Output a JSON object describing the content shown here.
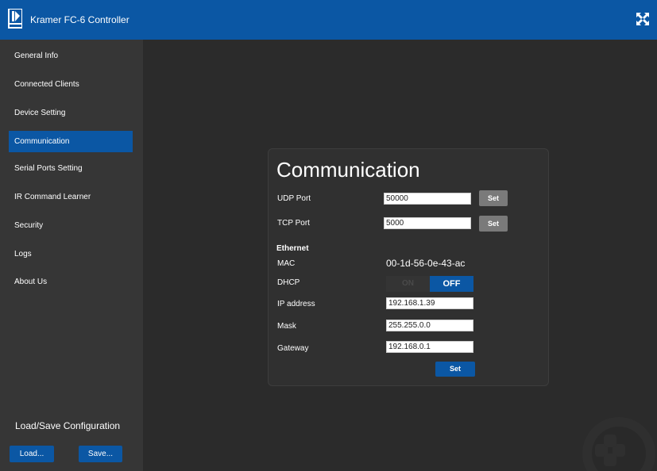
{
  "header": {
    "title": "Kramer FC-6 Controller",
    "logo_icon": "kramer-logo",
    "fullscreen_icon": "fullscreen-icon"
  },
  "sidebar": {
    "items": [
      {
        "label": "General Info",
        "active": false
      },
      {
        "label": "Connected Clients",
        "active": false
      },
      {
        "label": "Device Setting",
        "active": false
      },
      {
        "label": "Communication",
        "active": true
      },
      {
        "label": "Serial Ports Setting",
        "active": false
      },
      {
        "label": "IR Command Learner",
        "active": false
      },
      {
        "label": "Security",
        "active": false
      },
      {
        "label": "Logs",
        "active": false
      },
      {
        "label": "About Us",
        "active": false
      }
    ],
    "config": {
      "title": "Load/Save Configuration",
      "load_label": "Load...",
      "save_label": "Save..."
    }
  },
  "main": {
    "title": "Communication",
    "udp": {
      "label": "UDP Port",
      "value": "50000",
      "button": "Set"
    },
    "tcp": {
      "label": "TCP Port",
      "value": "5000",
      "button": "Set"
    },
    "ethernet": {
      "heading": "Ethernet",
      "mac_label": "MAC",
      "mac_value": "00-1d-56-0e-43-ac",
      "dhcp_label": "DHCP",
      "dhcp_on": "ON",
      "dhcp_off": "OFF",
      "dhcp_state": "OFF",
      "ip_label": "IP address",
      "ip_value": "192.168.1.39",
      "mask_label": "Mask",
      "mask_value": "255.255.0.0",
      "gateway_label": "Gateway",
      "gateway_value": "192.168.0.1",
      "set_button": "Set"
    }
  },
  "colors": {
    "accent": "#0b57a4",
    "background": "#2b2b2b",
    "sidebar": "#363636",
    "button_gray": "#7a7a7a"
  }
}
